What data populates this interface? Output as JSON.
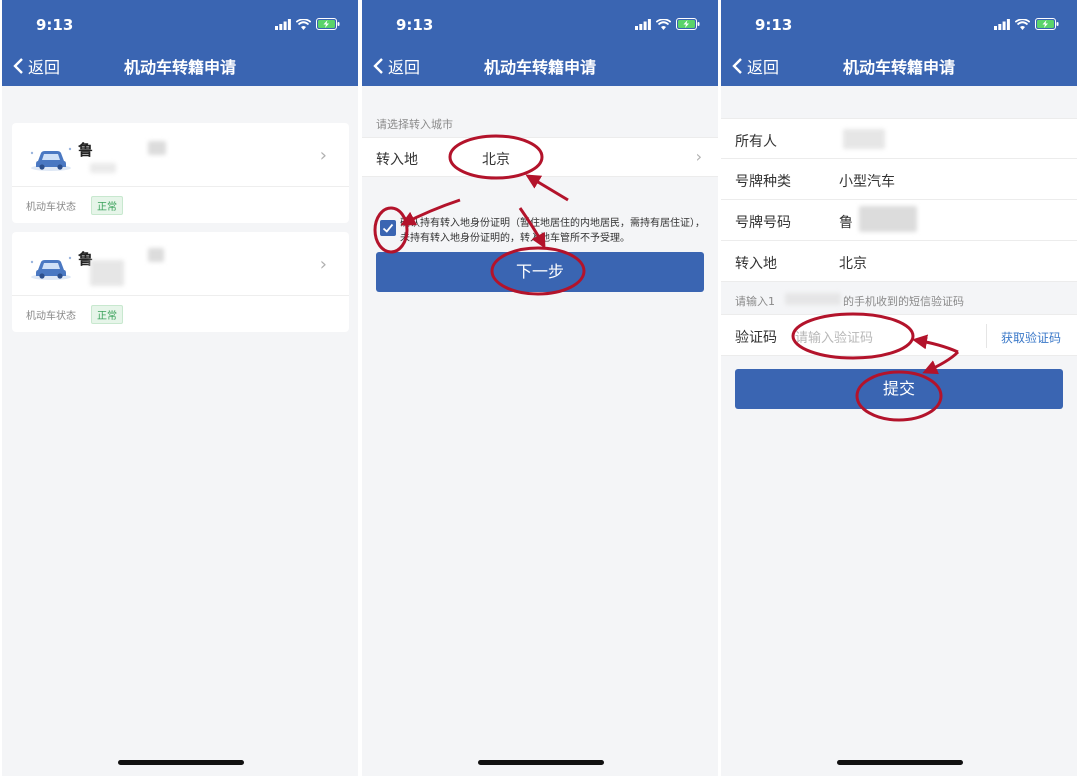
{
  "status": {
    "time": "9:13"
  },
  "nav": {
    "back_label": "返回",
    "title": "机动车转籍申请"
  },
  "colors": {
    "nav_bg": "#3a65b2",
    "accent": "#3a65b2",
    "annotation": "#b3132b",
    "status_ok": "#3aa15a"
  },
  "screen1": {
    "vehicles": [
      {
        "plate_prefix": "鲁",
        "status_label": "机动车状态",
        "status": "正常"
      },
      {
        "plate_prefix": "鲁",
        "status_label": "机动车状态",
        "status": "正常"
      }
    ]
  },
  "screen2": {
    "section_caption": "请选择转入城市",
    "transfer_label": "转入地",
    "transfer_value": "北京",
    "agreement_checked": true,
    "agreement_text": "确认持有转入地身份证明（暂住地居住的内地居民，需持有居住证），未持有转入地身份证明的，转入地车管所不予受理。",
    "next_button": "下一步"
  },
  "screen3": {
    "rows": [
      {
        "label": "所有人",
        "value": ""
      },
      {
        "label": "号牌种类",
        "value": "小型汽车"
      },
      {
        "label": "号牌号码",
        "value": "鲁"
      },
      {
        "label": "转入地",
        "value": "北京"
      }
    ],
    "sms_hint_prefix": "请输入1",
    "sms_hint_suffix": "的手机收到的短信验证码",
    "code_label": "验证码",
    "code_placeholder": "请输入验证码",
    "get_code": "获取验证码",
    "submit_button": "提交"
  }
}
